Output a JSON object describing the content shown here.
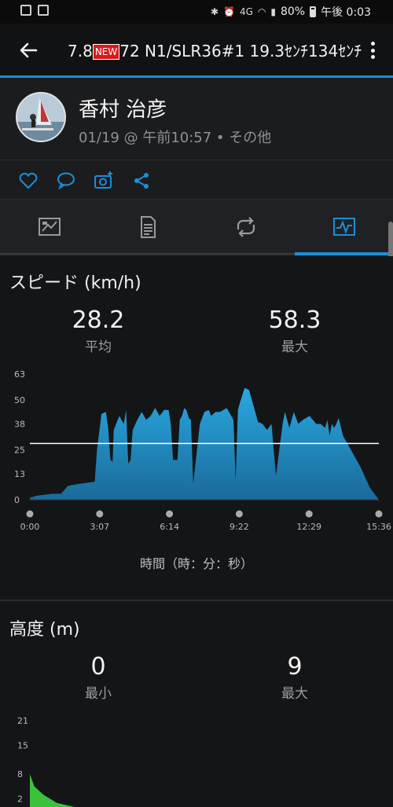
{
  "status_bar": {
    "battery": "80%",
    "time": "午後 0:03",
    "network": "4G"
  },
  "header": {
    "title_pre": "7.8",
    "badge": "NEW",
    "title_post": "72 N1/SLR36#1 19.3ｾﾝﾁ134ｾﾝﾁ"
  },
  "profile": {
    "name": "香村 治彦",
    "meta": "01/19 @ 午前10:57 • その他"
  },
  "speed": {
    "title": "スピード (km/h)",
    "avg": {
      "value": "28.2",
      "label": "平均"
    },
    "max": {
      "value": "58.3",
      "label": "最大"
    },
    "xlabel": "時間（時：分：秒）"
  },
  "altitude": {
    "title": "高度 (m)",
    "min": {
      "value": "0",
      "label": "最小"
    },
    "max": {
      "value": "9",
      "label": "最大"
    }
  },
  "colors": {
    "accent": "#1d8ed6",
    "chart_fill": "#29a8e0",
    "altitude_fill": "#3cc13c"
  },
  "chart_data": [
    {
      "type": "area",
      "title": "スピード (km/h)",
      "xlabel": "時間（時：分：秒）",
      "x_ticks": [
        "0:00",
        "3:07",
        "6:14",
        "9:22",
        "12:29",
        "15:36"
      ],
      "y_ticks": [
        0,
        13,
        25,
        38,
        50,
        63
      ],
      "ylim": [
        0,
        63
      ],
      "xlim": [
        0,
        15.6
      ],
      "average_line": 28.2,
      "grid": false,
      "x": [
        0,
        0.3,
        1,
        1.4,
        1.7,
        2.2,
        2.9,
        3.0,
        3.2,
        3.4,
        3.5,
        3.6,
        3.7,
        3.75,
        4.0,
        4.2,
        4.3,
        4.4,
        4.5,
        4.6,
        4.8,
        5.0,
        5.2,
        5.4,
        5.6,
        5.8,
        6.0,
        6.2,
        6.3,
        6.4,
        6.6,
        6.7,
        6.8,
        6.9,
        7.0,
        7.1,
        7.2,
        7.3,
        7.6,
        7.8,
        8.0,
        8.1,
        8.3,
        8.5,
        8.8,
        9.0,
        9.1,
        9.2,
        9.3,
        9.4,
        9.6,
        9.8,
        10.0,
        10.2,
        10.4,
        10.6,
        10.8,
        11.0,
        11.3,
        11.4,
        11.5,
        11.6,
        11.8,
        12.0,
        12.2,
        12.5,
        12.8,
        13.0,
        13.2,
        13.3,
        13.4,
        13.5,
        13.6,
        13.7,
        13.8,
        14.0,
        14.2,
        14.5,
        14.8,
        15.0,
        15.2,
        15.6
      ],
      "y": [
        1,
        2,
        3,
        3,
        7,
        8,
        9,
        25,
        43,
        44,
        36,
        20,
        19,
        35,
        42,
        38,
        45,
        18,
        20,
        35,
        40,
        44,
        40,
        42,
        46,
        42,
        45,
        45,
        38,
        20,
        20,
        40,
        42,
        46,
        45,
        41,
        40,
        8,
        38,
        44,
        45,
        42,
        44,
        44,
        46,
        42,
        40,
        10,
        45,
        49,
        56,
        55,
        47,
        39,
        38,
        35,
        38,
        12,
        38,
        44,
        40,
        36,
        44,
        38,
        40,
        42,
        38,
        38,
        36,
        40,
        32,
        38,
        36,
        38,
        41,
        32,
        28,
        22,
        16,
        11,
        6,
        0
      ]
    },
    {
      "type": "area",
      "title": "高度 (m)",
      "y_ticks": [
        2,
        8,
        15,
        21
      ],
      "ylim": [
        0,
        21
      ],
      "x": [
        0,
        0.2,
        0.6,
        1.2,
        2.0,
        15.6
      ],
      "y": [
        8,
        5,
        3,
        1,
        0,
        0
      ]
    }
  ]
}
